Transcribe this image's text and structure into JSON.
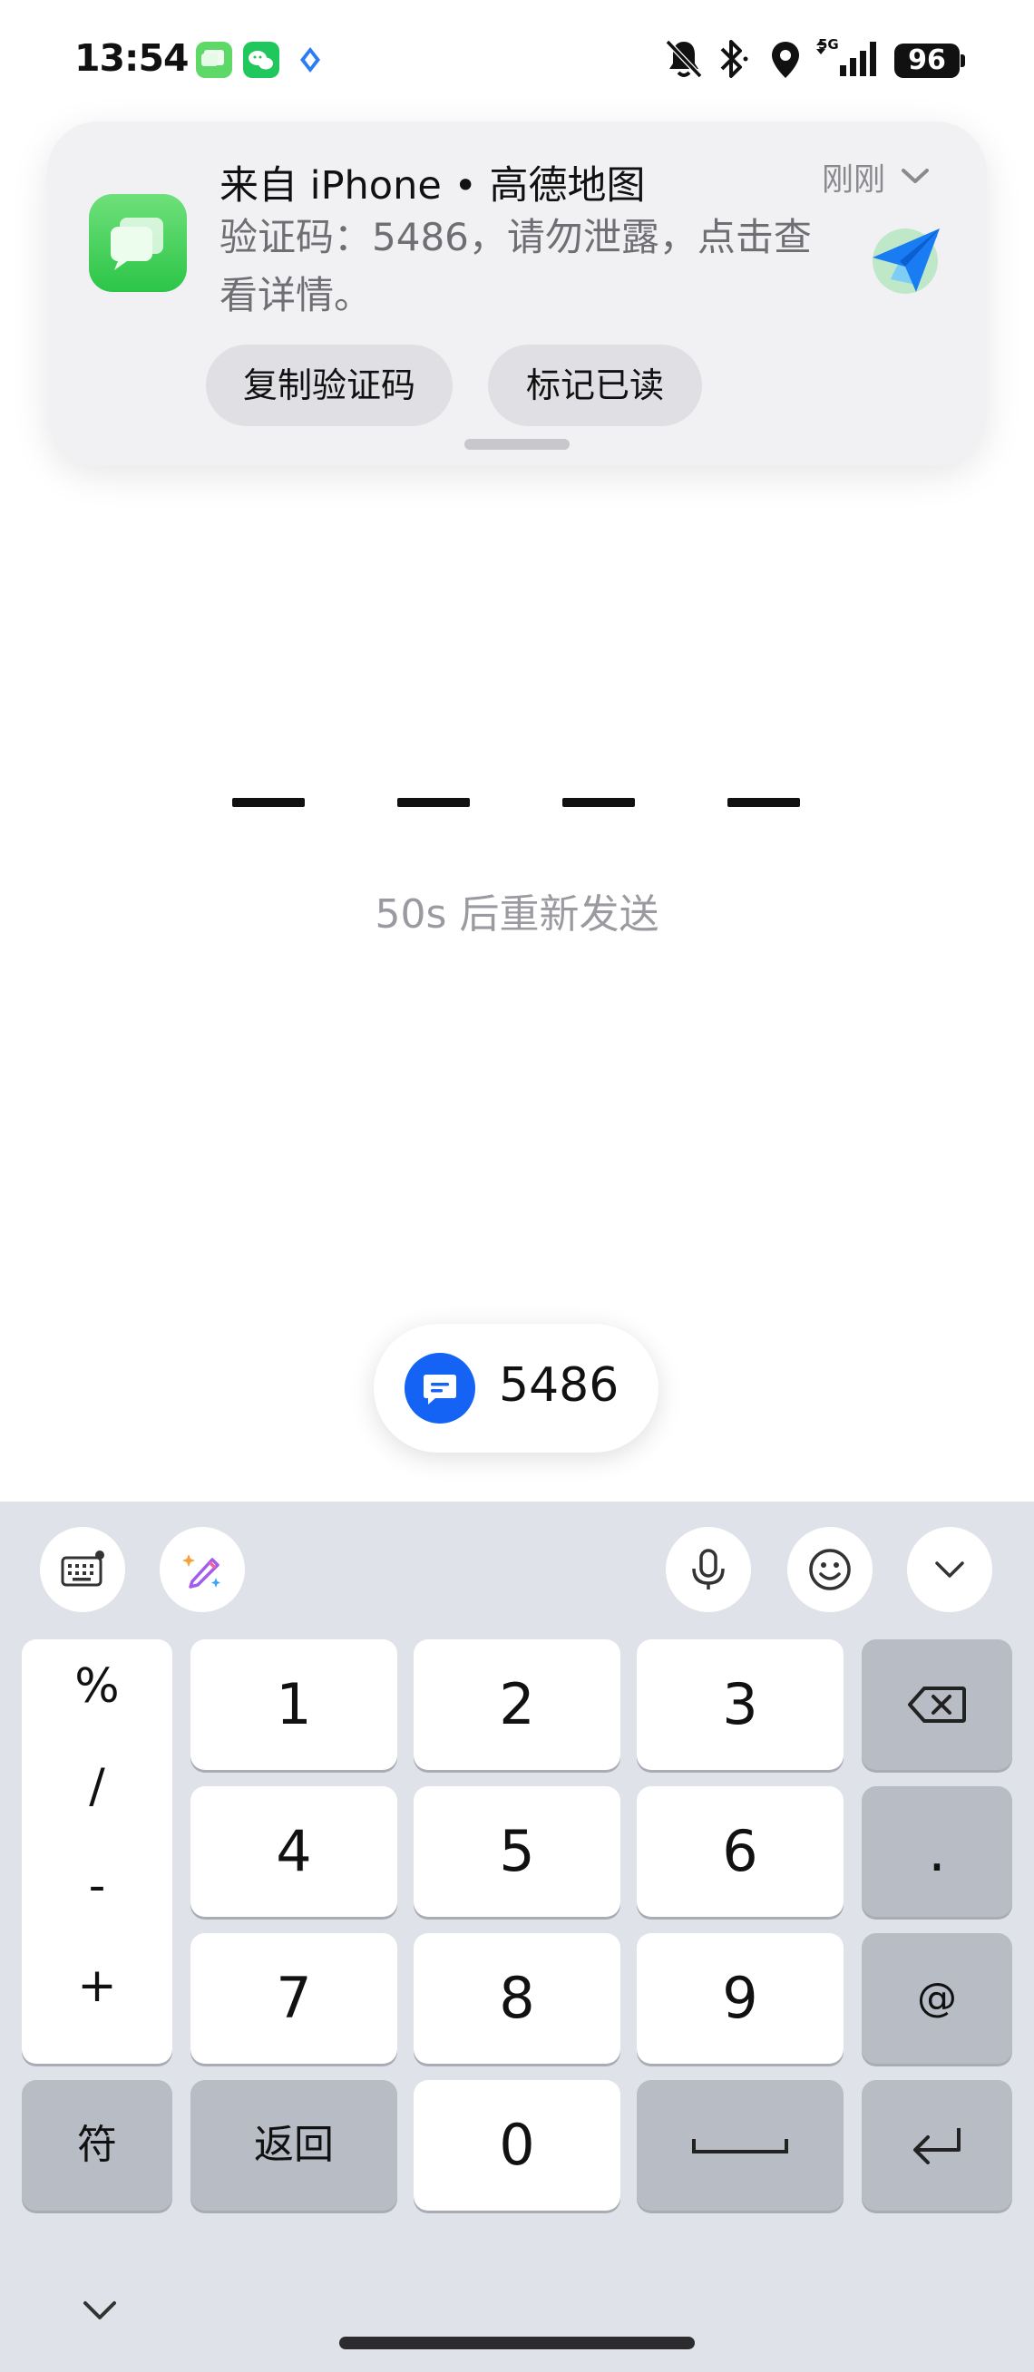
{
  "status_bar": {
    "time": "13:54",
    "network": "5G",
    "battery": "96",
    "icons": [
      "messages-icon",
      "wechat-icon",
      "app-icon",
      "mute-bell-icon",
      "bluetooth-icon",
      "location-icon",
      "signal-icon"
    ]
  },
  "notification": {
    "title": "来自 iPhone • 高德地图",
    "time": "刚刚",
    "body": "验证码：5486，请勿泄露，点击查看详情。",
    "copy_button": "复制验证码",
    "mark_read_button": "标记已读"
  },
  "code_entry": {
    "slots": 4,
    "resend_text": "50s 后重新发送"
  },
  "suggestion": {
    "code": "5486"
  },
  "keyboard": {
    "symbols": [
      "%",
      "/",
      "-",
      "+"
    ],
    "digits": [
      "1",
      "2",
      "3",
      "4",
      "5",
      "6",
      "7",
      "8",
      "9",
      "0"
    ],
    "dot": ".",
    "at": "@",
    "fu_label": "符",
    "back_label": "返回"
  },
  "colors": {
    "accent": "#1463f5",
    "keyboard_bg": "#dfe2e8",
    "notification_bg": "#f1f1f3"
  }
}
